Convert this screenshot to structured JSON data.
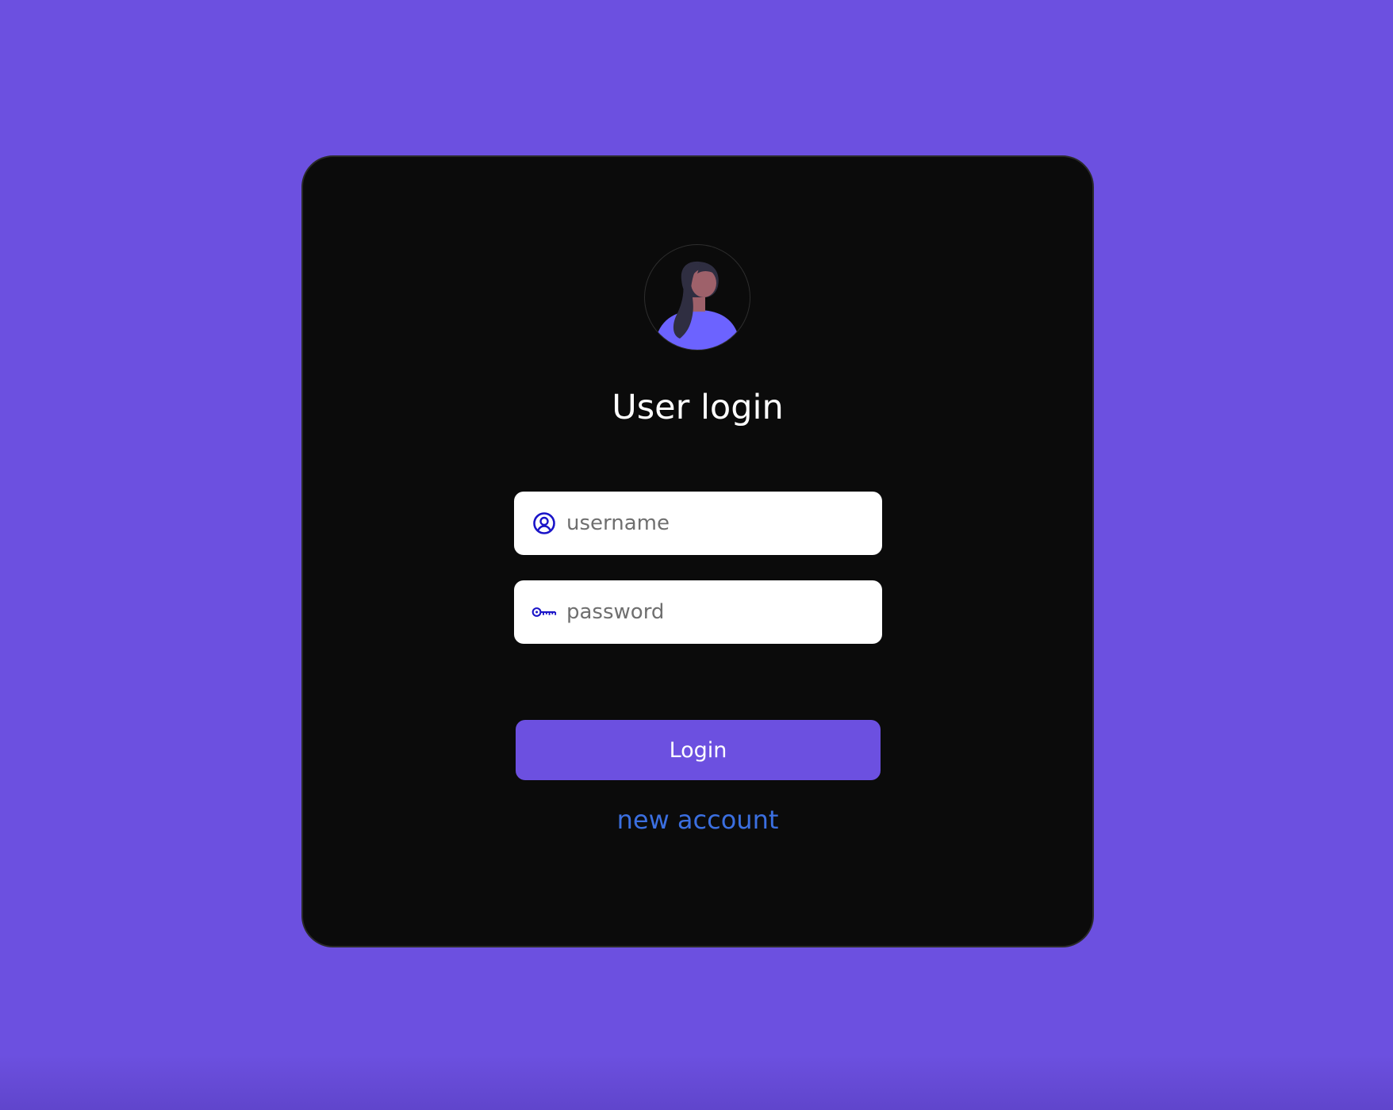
{
  "page": {
    "background_color": "#6c50e0"
  },
  "card": {
    "background_color": "#0b0b0b",
    "avatar_icon": "woman-avatar-icon",
    "title": "User login",
    "username": {
      "icon": "user-circle-icon",
      "placeholder": "username",
      "value": ""
    },
    "password": {
      "icon": "key-icon",
      "placeholder": "password",
      "value": ""
    },
    "login_button_label": "Login",
    "login_button_color": "#6c50e0",
    "new_account_link": "new account",
    "link_color": "#3b6fe0",
    "icon_color": "#1a14c8"
  }
}
